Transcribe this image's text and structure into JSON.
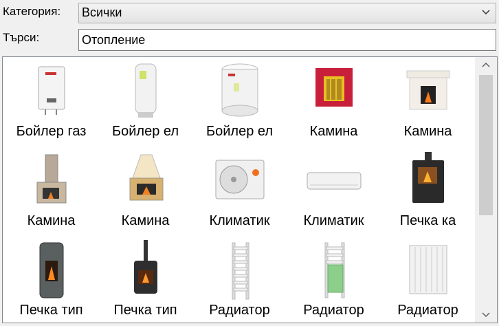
{
  "category": {
    "label": "Категория:",
    "value": "Всички"
  },
  "search": {
    "label": "Търси:",
    "value": "Отопление"
  },
  "items": [
    {
      "caption": "Бойлер газ",
      "icon": "gas-boiler-icon"
    },
    {
      "caption": "Бойлер ел",
      "icon": "electric-boiler-icon"
    },
    {
      "caption": "Бойлер ел",
      "icon": "round-boiler-icon"
    },
    {
      "caption": "Камина",
      "icon": "red-fireplace-icon"
    },
    {
      "caption": "Камина",
      "icon": "white-fireplace-icon"
    },
    {
      "caption": "Камина",
      "icon": "stone-fireplace-icon"
    },
    {
      "caption": "Камина",
      "icon": "corner-fireplace-icon"
    },
    {
      "caption": "Климатик",
      "icon": "ac-outdoor-unit-icon"
    },
    {
      "caption": "Климатик",
      "icon": "ac-indoor-unit-icon"
    },
    {
      "caption": "Печка ка",
      "icon": "black-stove-icon"
    },
    {
      "caption": "Печка тип",
      "icon": "tall-stove-icon"
    },
    {
      "caption": "Печка тип",
      "icon": "pipe-stove-icon"
    },
    {
      "caption": "Радиатор",
      "icon": "towel-radiator-icon"
    },
    {
      "caption": "Радиатор",
      "icon": "towel-radiator-green-icon"
    },
    {
      "caption": "Радиатор",
      "icon": "panel-radiator-icon"
    }
  ]
}
